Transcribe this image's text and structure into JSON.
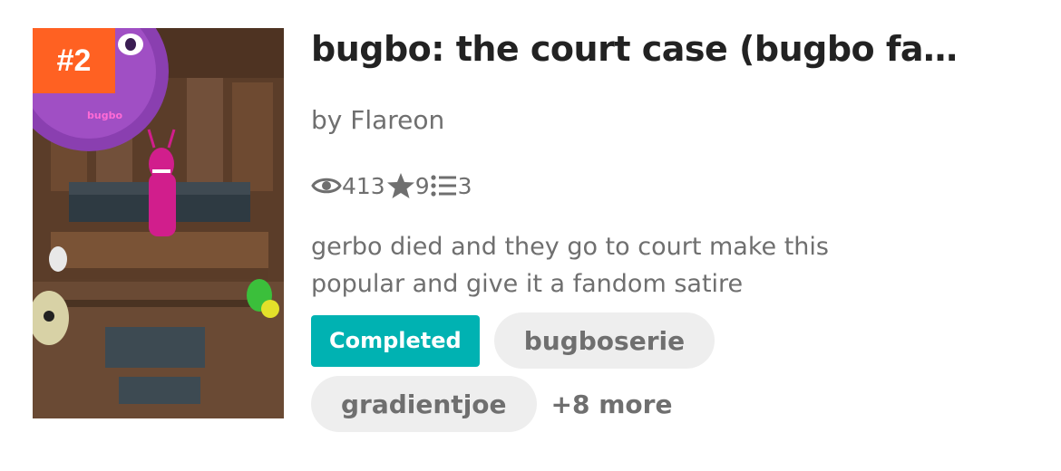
{
  "story": {
    "rank": "#2",
    "title": "bugbo: the court case (bugbo fa…",
    "author": "by Flareon",
    "cover_alt": "courtroom scene with purple and magenta characters"
  },
  "stats": {
    "reads_icon": "eye-icon",
    "reads": "413",
    "votes_icon": "star-icon",
    "votes": "9",
    "parts_icon": "list-icon",
    "parts": "3"
  },
  "description": {
    "line1": "gerbo died and they go to court make this",
    "line2": "popular and give it a fandom satire"
  },
  "tags": {
    "status": "Completed",
    "items": [
      "bugboserie",
      "gradientjoe"
    ],
    "more": "+8 more"
  },
  "colors": {
    "rank_badge": "#ff6122",
    "completed_badge": "#00b2b2",
    "tag_bg": "#eeeeee",
    "title_text": "#222222",
    "meta_text": "#6f6f6f"
  }
}
